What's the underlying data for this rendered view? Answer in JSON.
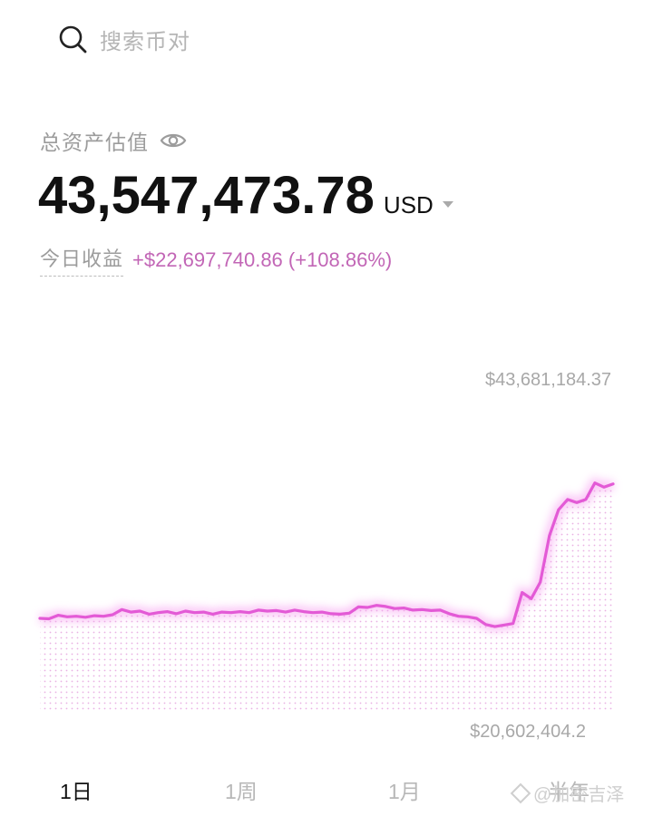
{
  "search": {
    "placeholder": "搜索币对"
  },
  "portfolio": {
    "label": "总资产估值",
    "balance": "43,547,473.78",
    "currency": "USD",
    "today_pnl_label": "今日收益",
    "today_pnl_value": "+$22,697,740.86 (+108.86%)"
  },
  "chart": {
    "max_label": "$43,681,184.37",
    "min_label": "$20,602,404.2",
    "accent_color": "#e35ad6"
  },
  "chart_data": {
    "type": "area",
    "ylim": [
      20602404.2,
      43681184.37
    ],
    "values": [
      23500000,
      23450000,
      23800000,
      23650000,
      23700000,
      23600000,
      23750000,
      23700000,
      23850000,
      24350000,
      24100000,
      24200000,
      23900000,
      24050000,
      24150000,
      23950000,
      24200000,
      24050000,
      24100000,
      23900000,
      24100000,
      24050000,
      24150000,
      24050000,
      24300000,
      24200000,
      24250000,
      24100000,
      24300000,
      24150000,
      24050000,
      24100000,
      23950000,
      23900000,
      24000000,
      24600000,
      24550000,
      24750000,
      24650000,
      24450000,
      24500000,
      24300000,
      24350000,
      24250000,
      24300000,
      23950000,
      23700000,
      23650000,
      23500000,
      22900000,
      22700000,
      22850000,
      23000000,
      26000000,
      25400000,
      27000000,
      31500000,
      34000000,
      35000000,
      34700000,
      35000000,
      36600000,
      36200000,
      36500000
    ]
  },
  "tabs": [
    {
      "label": "1日",
      "active": true
    },
    {
      "label": "1周",
      "active": false
    },
    {
      "label": "1月",
      "active": false
    },
    {
      "label": "半年",
      "active": false
    }
  ],
  "watermark": {
    "text": "@加密吉泽"
  },
  "icons": {
    "search": "search-icon",
    "visibility": "eye-icon",
    "caret": "caret-down-icon",
    "watermark": "diamond-icon"
  }
}
